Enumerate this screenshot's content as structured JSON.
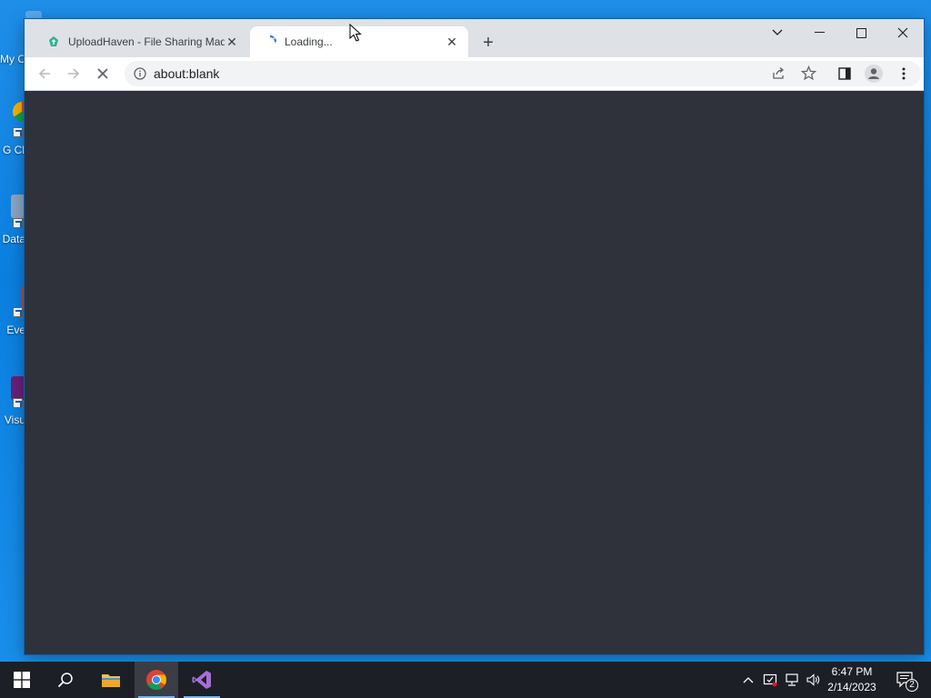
{
  "desktop": {
    "icons": [
      {
        "name": "My Computer",
        "label": "My C"
      },
      {
        "name": "Google Chrome",
        "label": "G Cl"
      },
      {
        "name": "Data",
        "label": "Data"
      },
      {
        "name": "Event",
        "label": "Eve"
      },
      {
        "name": "Visual Studio",
        "label": "Visu"
      }
    ]
  },
  "browser": {
    "tabs": [
      {
        "title": "UploadHaven - File Sharing Made",
        "favicon": "uploadhaven-icon",
        "state": "inactive"
      },
      {
        "title": "Loading...",
        "favicon": "loading-spinner-icon",
        "state": "active"
      }
    ],
    "address": {
      "url": "about:blank"
    },
    "content_bg": "#30323b"
  },
  "taskbar": {
    "clock": {
      "time": "6:47 PM",
      "date": "2/14/2023"
    },
    "notification_count": "2",
    "pinned": [
      "start-icon",
      "search-icon",
      "file-explorer-icon",
      "chrome-icon",
      "visual-studio-icon"
    ]
  },
  "colors": {
    "desktop": "#1a8be6",
    "taskbar": "#1c1f26",
    "tabstrip": "#dee1e6"
  }
}
